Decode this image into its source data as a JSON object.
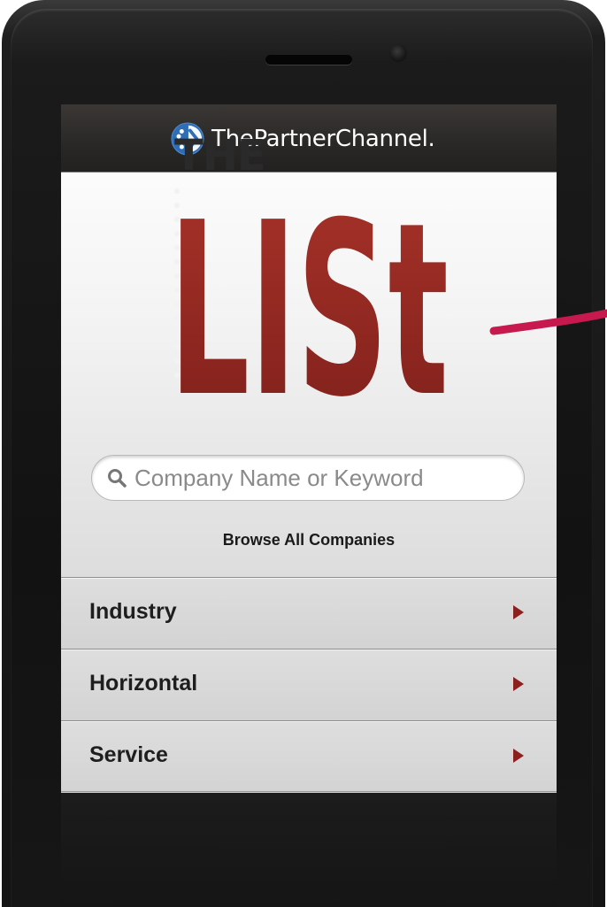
{
  "header": {
    "brand_name": "ThePartnerChannel."
  },
  "logo": {
    "line1": "THE",
    "line2": "LISt"
  },
  "search": {
    "placeholder": "Company Name or Keyword",
    "value": ""
  },
  "browse": {
    "label": "Browse All Companies"
  },
  "categories": [
    {
      "label": "Industry"
    },
    {
      "label": "Horizontal"
    },
    {
      "label": "Service"
    }
  ],
  "colors": {
    "brand_red": "#9b2c24",
    "arrow_red": "#8e1f1f",
    "pointer_pink": "#c8194e",
    "brand_blue": "#2f6db4"
  },
  "icons": {
    "brand": "partner-channel-logo-icon",
    "search": "search-icon",
    "chevron": "chevron-right-icon"
  }
}
